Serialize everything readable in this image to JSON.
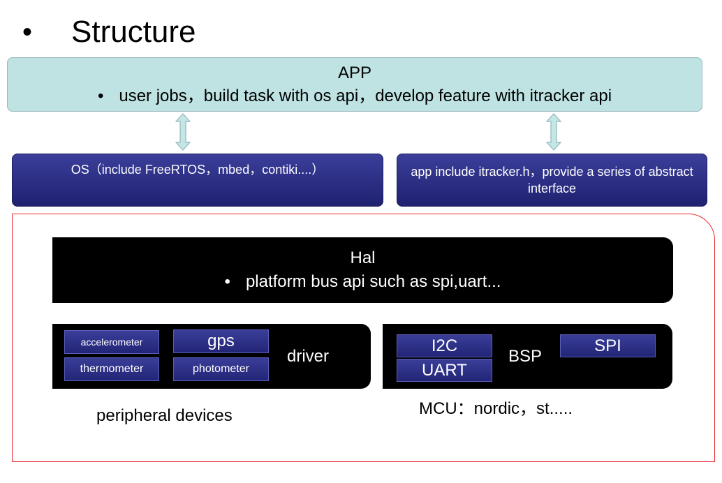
{
  "slide": {
    "bullet": "•",
    "title": "Structure"
  },
  "app": {
    "title": "APP",
    "bullet": "•",
    "line": "user jobs，build task with os api，develop feature with itracker api"
  },
  "os_box": {
    "text": "OS（include FreeRTOS，mbed，contiki....）"
  },
  "itracker_box": {
    "text": "app include itracker.h，provide a series of abstract interface"
  },
  "hal": {
    "title": "Hal",
    "bullet": "•",
    "line": "platform bus api such as spi,uart..."
  },
  "driver": {
    "label": "driver",
    "items": [
      "accelerometer",
      "gps",
      "thermometer",
      "photometer"
    ]
  },
  "bsp": {
    "label": "BSP",
    "items": [
      "I2C",
      "UART",
      "SPI"
    ]
  },
  "captions": {
    "peripheral": "peripheral devices",
    "mcu": "MCU：nordic，st....."
  },
  "colors": {
    "app_fill": "#bfe3e3",
    "blue_fill": "#2a2d84",
    "frame_border": "#e8262a",
    "arrow_fill": "#c6e6e6"
  }
}
